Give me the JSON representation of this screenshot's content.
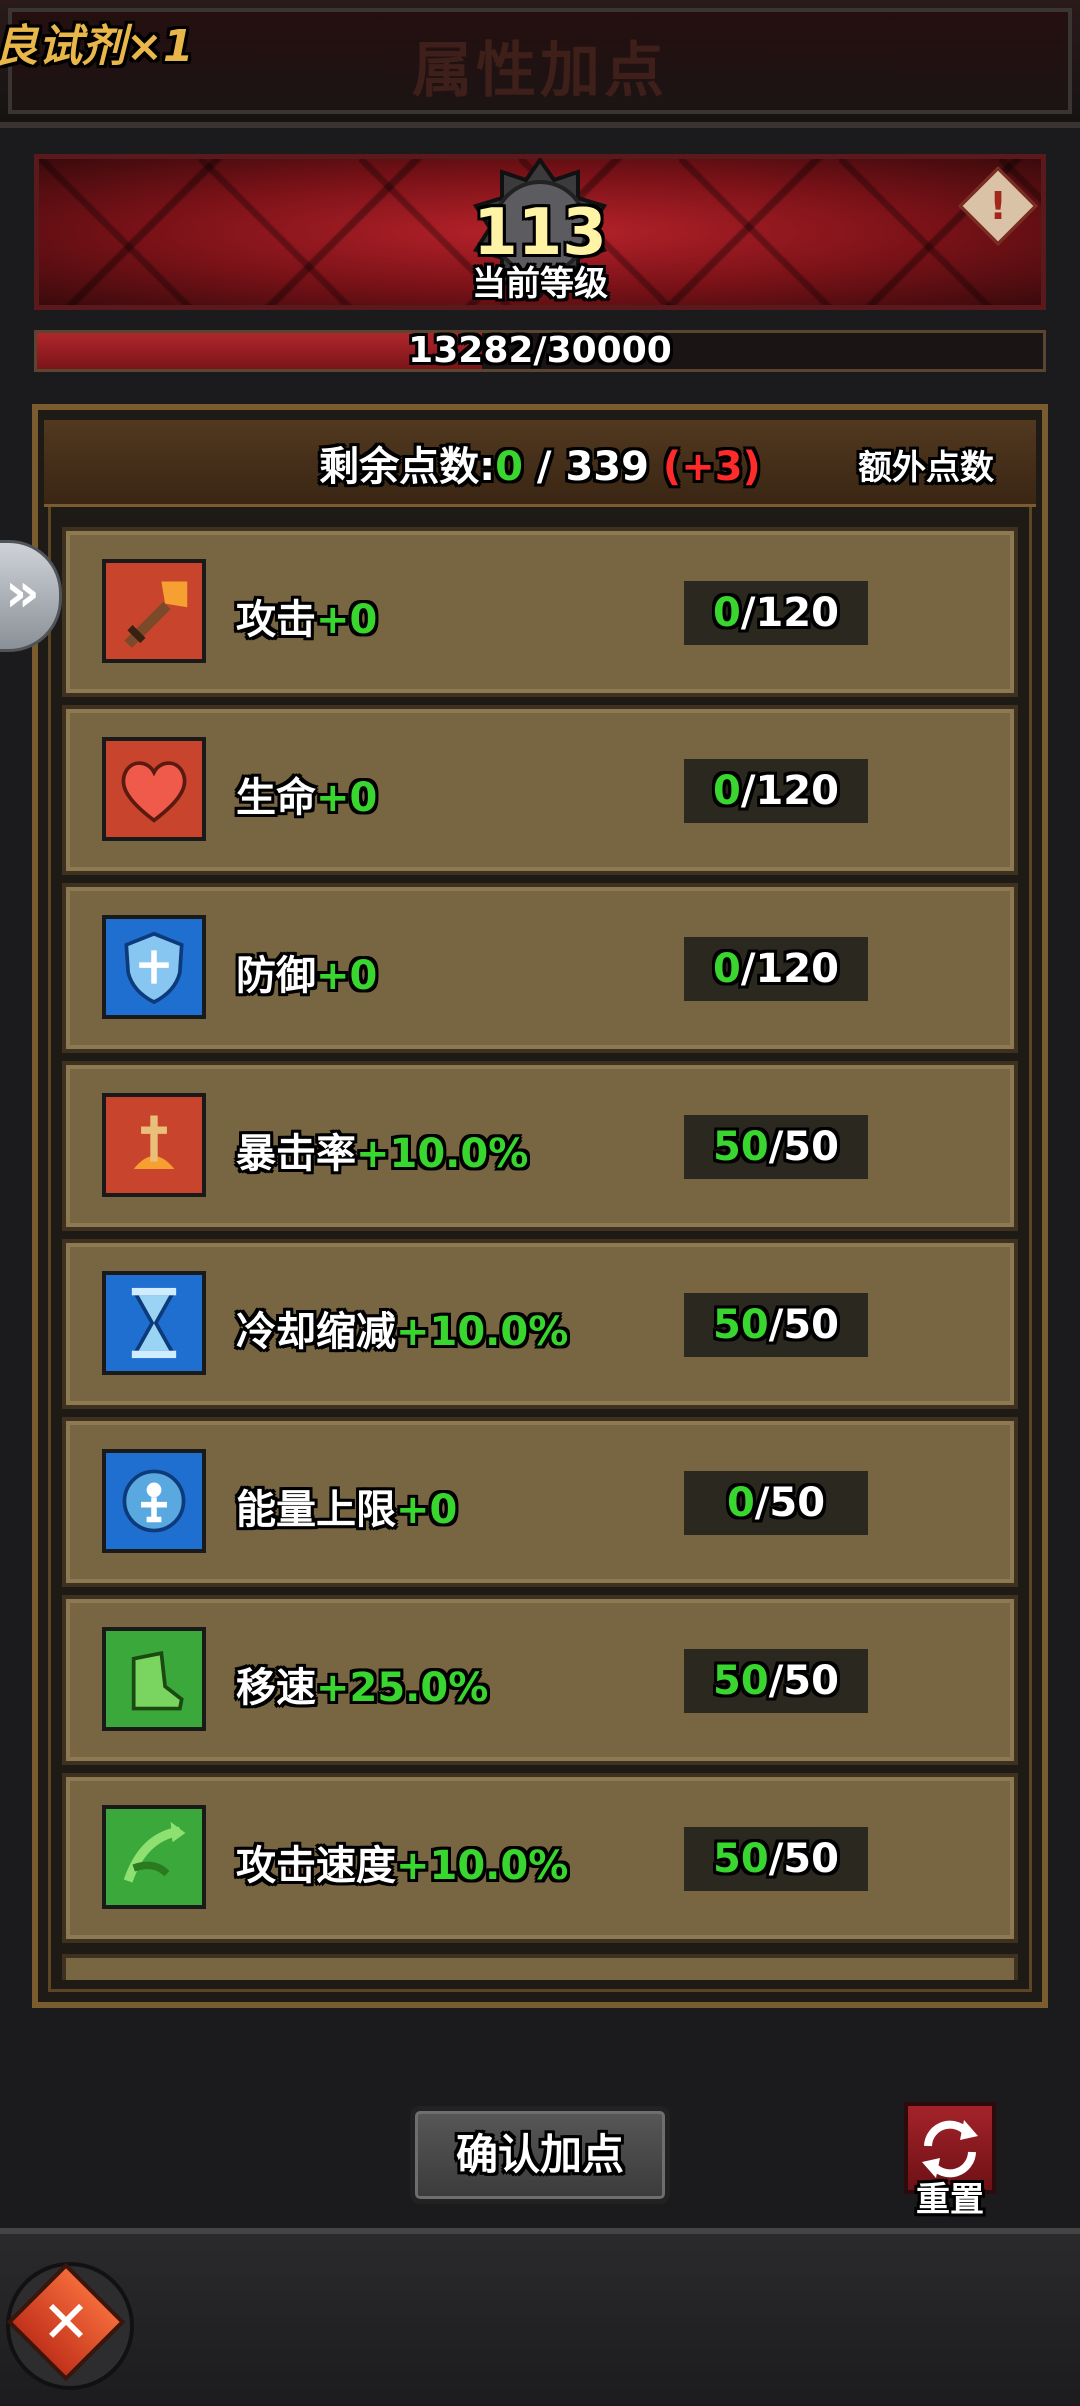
{
  "header": {
    "left_text": "良试剂×1",
    "title": "属性加点"
  },
  "level": {
    "value": "113",
    "label": "当前等级",
    "alert_symbol": "!"
  },
  "exp": {
    "text": "13282/30000",
    "current": 13282,
    "max": 30000
  },
  "points": {
    "label": "剩余点数:",
    "available": "0",
    "separator": " / ",
    "total": "339",
    "bonus": "(+3)",
    "extra_button": "额外点数"
  },
  "attributes": [
    {
      "name": "攻击",
      "bonus": "+0",
      "current": "0",
      "max": "/120",
      "icon": "sword-icon",
      "color": "#c9442c"
    },
    {
      "name": "生命",
      "bonus": "+0",
      "current": "0",
      "max": "/120",
      "icon": "heart-icon",
      "color": "#c9442c"
    },
    {
      "name": "防御",
      "bonus": "+0",
      "current": "0",
      "max": "/120",
      "icon": "shield-icon",
      "color": "#1f6fd1"
    },
    {
      "name": "暴击率",
      "bonus": "+10.0%",
      "current": "50",
      "max": "/50",
      "icon": "crit-icon",
      "color": "#c9442c"
    },
    {
      "name": "冷却缩减",
      "bonus": "+10.0%",
      "current": "50",
      "max": "/50",
      "icon": "hourglass-icon",
      "color": "#1f6fd1"
    },
    {
      "name": "能量上限",
      "bonus": "+0",
      "current": "0",
      "max": "/50",
      "icon": "energy-icon",
      "color": "#1f6fd1"
    },
    {
      "name": "移速",
      "bonus": "+25.0%",
      "current": "50",
      "max": "/50",
      "icon": "boot-icon",
      "color": "#3aa83a"
    },
    {
      "name": "攻击速度",
      "bonus": "+10.0%",
      "current": "50",
      "max": "/50",
      "icon": "attack-speed-icon",
      "color": "#3aa83a"
    }
  ],
  "buttons": {
    "confirm": "确认加点",
    "reset": "重置"
  },
  "side_tab_symbol": "»",
  "close_symbol": "✕"
}
